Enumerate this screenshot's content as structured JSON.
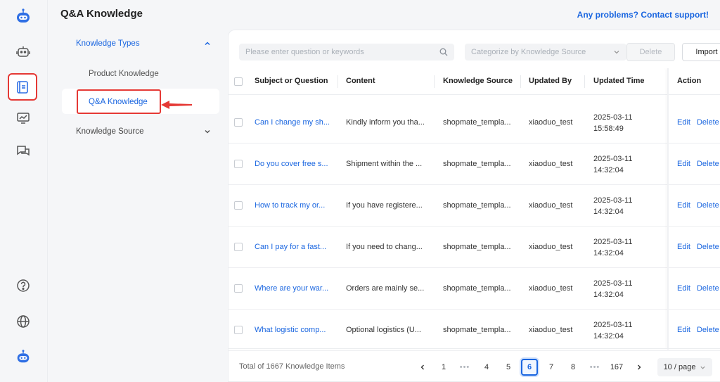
{
  "header": {
    "title": "Q&A Knowledge",
    "support_link": "Any problems? Contact support!"
  },
  "sidenav": {
    "group1": "Knowledge Types",
    "item1": "Product Knowledge",
    "item2": "Q&A Knowledge",
    "group2": "Knowledge Source"
  },
  "toolbar": {
    "search_placeholder": "Please enter question or keywords",
    "select_placeholder": "Categorize by Knowledge Source",
    "delete_label": "Delete",
    "import_label": "Import"
  },
  "table": {
    "columns": [
      "Subject or Question",
      "Content",
      "Knowledge Source",
      "Updated By",
      "Updated Time",
      "Action"
    ],
    "rows": [
      {
        "question": "Can I change my sh...",
        "content": "Kindly inform you tha...",
        "source": "shopmate_templa...",
        "by": "xiaoduo_test",
        "date": "2025-03-11",
        "time": "15:58:49"
      },
      {
        "question": "Do you cover free s...",
        "content": "Shipment within the ...",
        "source": "shopmate_templa...",
        "by": "xiaoduo_test",
        "date": "2025-03-11",
        "time": "14:32:04"
      },
      {
        "question": "How to track my or...",
        "content": "If you have registere...",
        "source": "shopmate_templa...",
        "by": "xiaoduo_test",
        "date": "2025-03-11",
        "time": "14:32:04"
      },
      {
        "question": "Can I pay for a fast...",
        "content": "If you need to chang...",
        "source": "shopmate_templa...",
        "by": "xiaoduo_test",
        "date": "2025-03-11",
        "time": "14:32:04"
      },
      {
        "question": "Where are your war...",
        "content": "Orders are mainly se...",
        "source": "shopmate_templa...",
        "by": "xiaoduo_test",
        "date": "2025-03-11",
        "time": "14:32:04"
      },
      {
        "question": "What logistic comp...",
        "content": "Optional logistics (U...",
        "source": "shopmate_templa...",
        "by": "xiaoduo_test",
        "date": "2025-03-11",
        "time": "14:32:04"
      }
    ],
    "edit_label": "Edit",
    "delete_label": "Delete"
  },
  "pagination": {
    "total": "Total of 1667 Knowledge Items",
    "pages": [
      "1",
      "•••",
      "4",
      "5",
      "6",
      "7",
      "8",
      "•••",
      "167"
    ],
    "current": "6",
    "per_page": "10 / page"
  },
  "colors": {
    "accent": "#1a66e0",
    "highlight": "#e53935"
  }
}
